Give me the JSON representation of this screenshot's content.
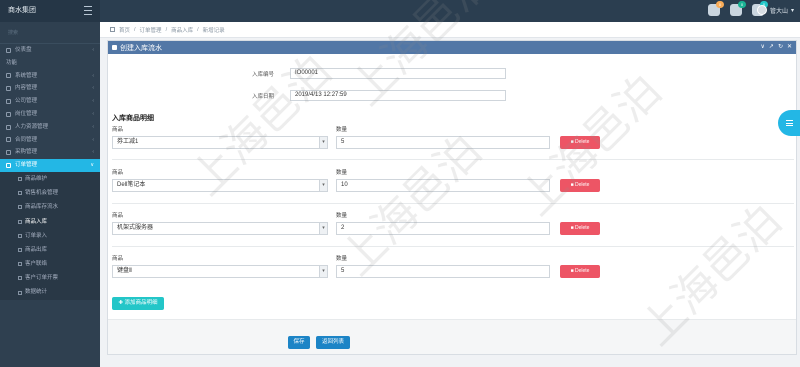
{
  "app": {
    "brand": "商水集团"
  },
  "header": {
    "icons": [
      {
        "name": "bell-icon",
        "badge": "0",
        "badge_color": "#f8ac59"
      },
      {
        "name": "mail-icon",
        "badge": "0",
        "badge_color": "#1ab394"
      },
      {
        "name": "task-icon",
        "badge": "0",
        "badge_color": "#23c6c8"
      }
    ],
    "user_name": "管大山"
  },
  "sidebar": {
    "search_label": "搜索",
    "items": [
      {
        "label": "仪表盘",
        "arrow": "‹"
      },
      {
        "label": "功能",
        "arrow": ""
      },
      {
        "label": "系统管理",
        "arrow": "‹"
      },
      {
        "label": "内容管理",
        "arrow": "‹"
      },
      {
        "label": "公司管理",
        "arrow": "‹"
      },
      {
        "label": "岗位管理",
        "arrow": "‹"
      },
      {
        "label": "人力资源管理",
        "arrow": "‹"
      },
      {
        "label": "合同管理",
        "arrow": "‹"
      },
      {
        "label": "采购管理",
        "arrow": "‹"
      },
      {
        "label": "订单管理",
        "arrow": "∨"
      }
    ],
    "sub_items": [
      {
        "label": "商品维护"
      },
      {
        "label": "销售机会管理"
      },
      {
        "label": "商品库存流水"
      },
      {
        "label": "商品入库"
      },
      {
        "label": "订单录入"
      },
      {
        "label": "商品出库"
      },
      {
        "label": "客户联络"
      },
      {
        "label": "客户订单开票"
      },
      {
        "label": "数据统计"
      }
    ]
  },
  "breadcrumb": [
    "首页",
    "订单管理",
    "商品入库",
    "新增记录"
  ],
  "panel": {
    "title": "创建入库流水",
    "tools": [
      "∨",
      "↗",
      "↻",
      "✕"
    ],
    "fields": {
      "code_label": "入库编号",
      "code_value": "IO00001",
      "date_label": "入库日期",
      "date_value": "2019/4/13 12:27:59"
    },
    "section_title": "入库商品明细",
    "product_label": "商品",
    "qty_label": "数量",
    "delete_label": "■ Delete",
    "rows": [
      {
        "product": "券工减1",
        "qty": "5"
      },
      {
        "product": "Dell笔记本",
        "qty": "10"
      },
      {
        "product": "机架式服务器",
        "qty": "2"
      },
      {
        "product": "键盘Ⅱ",
        "qty": "5"
      }
    ],
    "add_label": "✚ 添加商品明细",
    "save_label": "保存",
    "back_label": "返回列表"
  },
  "watermark": "上海邑泊"
}
